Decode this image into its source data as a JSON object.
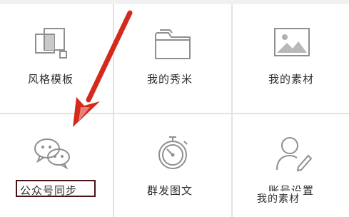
{
  "menu": {
    "items": [
      {
        "label": "风格模板",
        "icon": "template-icon"
      },
      {
        "label": "我的秀米",
        "icon": "folder-icon"
      },
      {
        "label": "我的素材",
        "icon": "image-icon"
      },
      {
        "label": "公众号同步",
        "icon": "wechat-icon"
      },
      {
        "label": "群发图文",
        "icon": "stopwatch-icon"
      },
      {
        "label": "账号设置",
        "icon": "user-edit-icon"
      }
    ]
  },
  "overlay_text": "我的素材",
  "colors": {
    "accent_arrow": "#d42a1c",
    "highlight_box": "#4a1414",
    "icon_stroke": "#8f8f8f",
    "divider": "#e3e3e3"
  }
}
